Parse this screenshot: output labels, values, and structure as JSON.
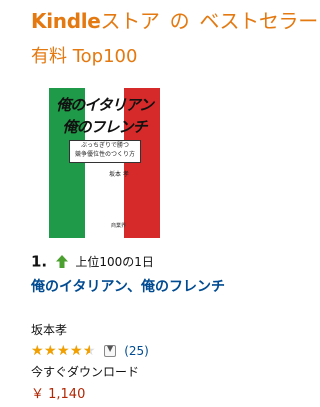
{
  "header": {
    "title_brand": "Kindle",
    "title_store": "ストア",
    "title_no": "の",
    "title_best": "ベストセラー",
    "subtitle": "有料 Top100"
  },
  "cover": {
    "line1": "俺のイタリアン",
    "line2": "俺のフレンチ",
    "box_line1": "ぶっちぎりで勝つ",
    "box_line2": "競争優位性のつくり方",
    "author": "坂本 孝",
    "publisher": "商業界"
  },
  "item": {
    "rank": "1.",
    "rank_note": "上位100の1日",
    "title": "俺のイタリアン、俺のフレンチ",
    "author": "坂本孝",
    "rating_stars": 4.5,
    "review_count": "(25)",
    "availability": "今すぐダウンロード",
    "price": "￥ 1,140"
  },
  "colors": {
    "accent": "#e47911",
    "link": "#004b91",
    "price": "#b12704",
    "star": "#f2a000",
    "arrow": "#4ca030"
  },
  "icons": {
    "rank_trend": "up-arrow-icon",
    "reviews_menu": "chevron-down-icon"
  }
}
